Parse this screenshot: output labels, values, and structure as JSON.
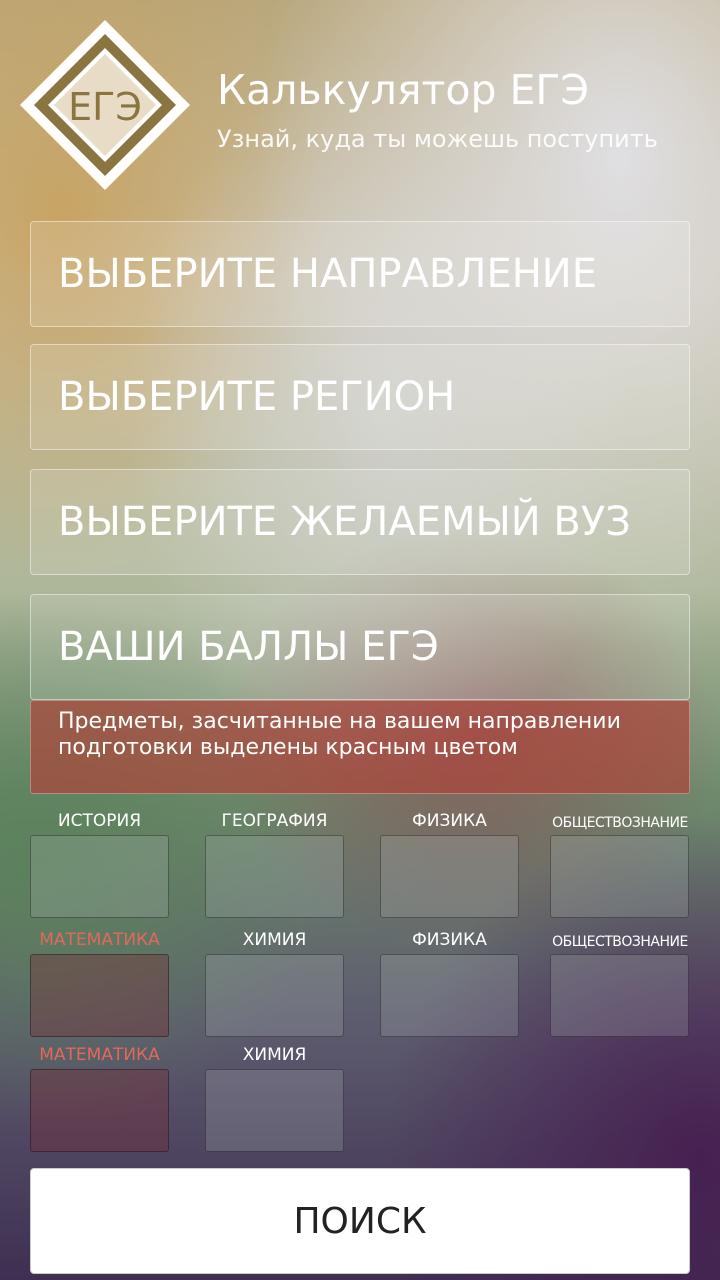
{
  "header": {
    "logo_text": "ЕГЭ",
    "title": "Калькулятор ЕГЭ",
    "subtitle": "Узнай, куда ты можешь поступить"
  },
  "selectors": {
    "direction": "ВЫБЕРИТЕ НАПРАВЛЕНИЕ",
    "region": "ВЫБЕРИТЕ РЕГИОН",
    "university": "ВЫБЕРИТЕ ЖЕЛАЕМЫЙ ВУЗ",
    "scores": "ВАШИ БАЛЛЫ ЕГЭ"
  },
  "notice": "Предметы, засчитанные на вашем направлении подготовки выделены красным цветом",
  "subjects": [
    {
      "label": "ИСТОРИЯ",
      "required": false
    },
    {
      "label": "ГЕОГРАФИЯ",
      "required": false
    },
    {
      "label": "ФИЗИКА",
      "required": false
    },
    {
      "label": "ОБЩЕСТВОЗНАНИЕ",
      "required": false
    },
    {
      "label": "МАТЕМАТИКА",
      "required": true
    },
    {
      "label": "ХИМИЯ",
      "required": false
    },
    {
      "label": "ФИЗИКА",
      "required": false
    },
    {
      "label": "ОБЩЕСТВОЗНАНИЕ",
      "required": false
    },
    {
      "label": "МАТЕМАТИКА",
      "required": true
    },
    {
      "label": "ХИМИЯ",
      "required": false
    }
  ],
  "search_button": "ПОИСК",
  "colors": {
    "required_subject": "#e06a5a",
    "notice_background": "#aa463c"
  }
}
